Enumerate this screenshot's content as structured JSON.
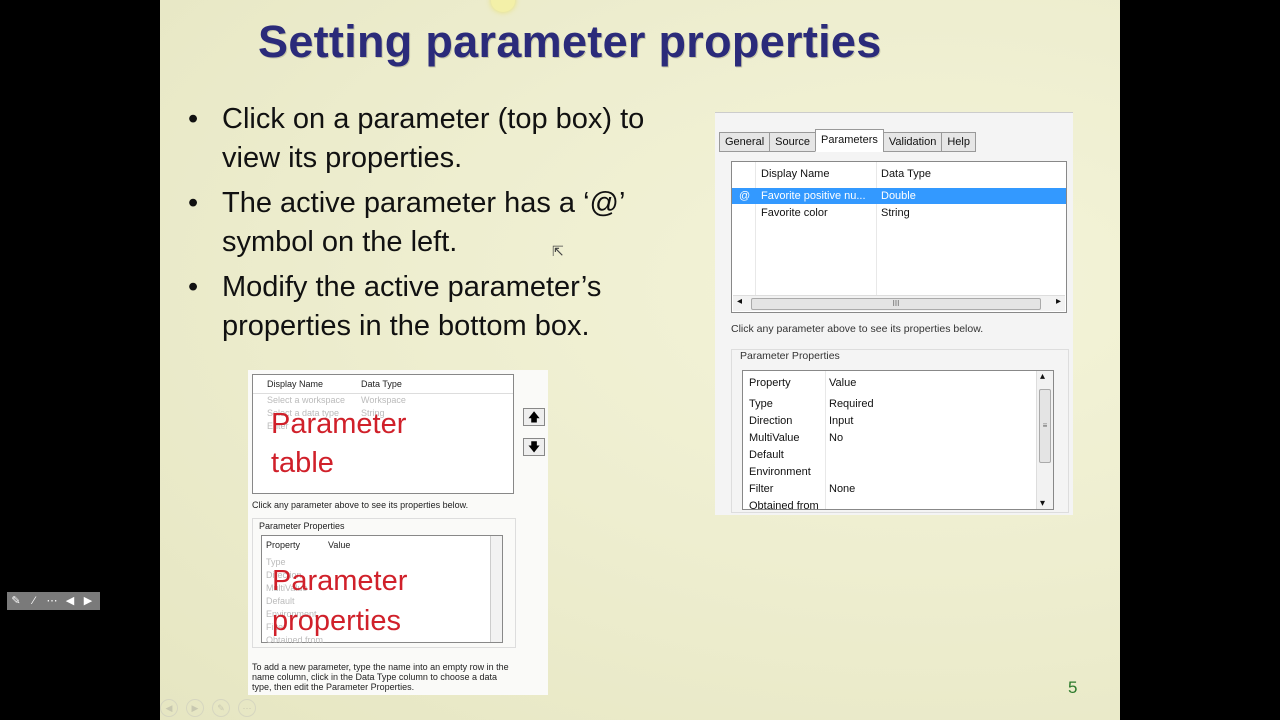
{
  "slide": {
    "title": "Setting parameter properties",
    "bullets": [
      "Click on a parameter (top box) to view its properties.",
      "The active parameter has a ‘@’ symbol on the left.",
      "Modify the active parameter’s properties in the bottom box."
    ],
    "page_number": "5"
  },
  "small_shot": {
    "col_display_name": "Display Name",
    "col_data_type": "Data Type",
    "rows": [
      {
        "name": "Select a workspace",
        "type": "Workspace"
      },
      {
        "name": "Select a data type",
        "type": "String"
      },
      {
        "name": "Enter",
        "type": ""
      }
    ],
    "overlay_table_1": "Parameter",
    "overlay_table_2": "table",
    "up_arrow": "🡅",
    "down_arrow": "🡇",
    "caption": "Click any parameter above to see its properties below.",
    "group_label": "Parameter Properties",
    "col_property": "Property",
    "col_value": "Value",
    "prop_rows": [
      "Type",
      "Direction",
      "MultiValue",
      "Default",
      "Environment",
      "Filter",
      "Obtained from"
    ],
    "overlay_props_1": "Parameter",
    "overlay_props_2": "properties",
    "footer": "To add a new parameter, type the name into an empty row in the name column, click in the Data Type column to choose a data type, then edit the Parameter Properties."
  },
  "big_shot": {
    "tabs": [
      "General",
      "Source",
      "Parameters",
      "Validation",
      "Help"
    ],
    "active_tab": "Parameters",
    "col_display_name": "Display Name",
    "col_data_type": "Data Type",
    "params": [
      {
        "marker": "@",
        "name": "Favorite positive nu...",
        "type": "Double",
        "selected": true
      },
      {
        "marker": "",
        "name": "Favorite color",
        "type": "String",
        "selected": false
      }
    ],
    "scroll_left": "◂",
    "scroll_right": "▸",
    "scroll_thumb": "III",
    "caption": "Click any parameter above to see its properties below.",
    "group_label": "Parameter Properties",
    "col_property": "Property",
    "col_value": "Value",
    "properties": [
      {
        "name": "Type",
        "value": "Required"
      },
      {
        "name": "Direction",
        "value": "Input"
      },
      {
        "name": "MultiValue",
        "value": "No"
      },
      {
        "name": "Default",
        "value": ""
      },
      {
        "name": "Environment",
        "value": ""
      },
      {
        "name": "Filter",
        "value": "None"
      },
      {
        "name": "Obtained from",
        "value": ""
      }
    ],
    "vscroll_up": "▴",
    "vscroll_down": "▾",
    "vscroll_thumb": "≡"
  },
  "toolbar": {
    "icons": [
      "pen-icon",
      "pointer-icon",
      "menu-icon",
      "prev-icon",
      "next-icon"
    ],
    "glyphs": [
      "✎",
      "⁄",
      "⋯",
      "◀",
      "▶"
    ]
  },
  "colors": {
    "title": "#2b2b7a",
    "overlay_red": "#d0202a",
    "selected_row": "#3399ff",
    "page_number": "#2b7a2b"
  }
}
